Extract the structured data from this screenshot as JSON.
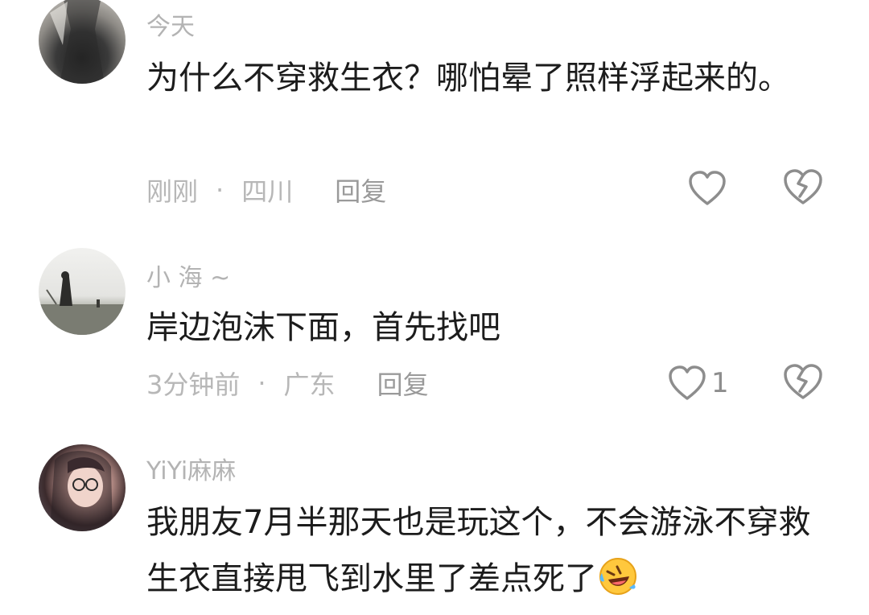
{
  "comments": [
    {
      "username": "今天",
      "text": "为什么不穿救生衣？哪怕晕了照样浮起来的。",
      "time": "刚刚",
      "separator": "·",
      "location": "四川",
      "reply_label": "回复",
      "likes": ""
    },
    {
      "username": "小 海 ~",
      "text": "岸边泡沫下面，首先找吧",
      "time": "3分钟前",
      "separator": "·",
      "location": "广东",
      "reply_label": "回复",
      "likes": "1"
    },
    {
      "username": "YiYi麻麻",
      "text": "我朋友7月半那天也是玩这个，不会游泳不穿救生衣直接甩飞到水里了差点死了",
      "emoji": "😂",
      "time": "",
      "location": "",
      "reply_label": "",
      "likes": ""
    }
  ],
  "icons": {
    "like": "heart-outline-icon",
    "dislike": "broken-heart-icon"
  },
  "colors": {
    "text": "#1c1c1c",
    "username": "#b3b3b3",
    "meta": "#b7b7b7",
    "icon": "#8d8d8d"
  }
}
